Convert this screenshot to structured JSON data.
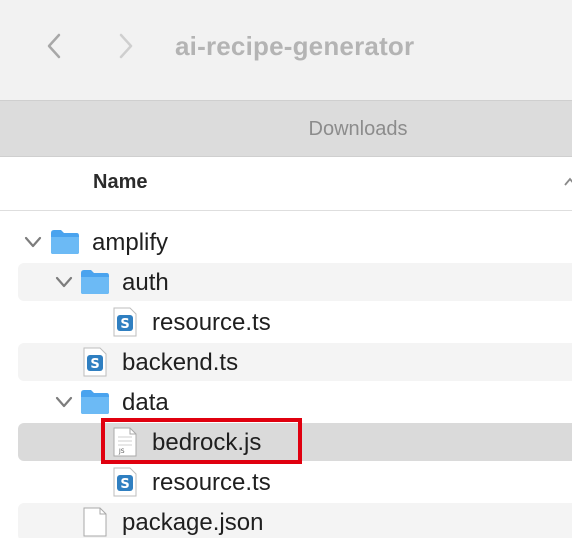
{
  "window": {
    "title": "ai-recipe-generator"
  },
  "tabbar": {
    "tab_label": "Downloads"
  },
  "columns": {
    "name_header": "Name"
  },
  "colors": {
    "highlight": "#e0000f",
    "folder": "#5aaef0",
    "swift_badge": "#2f7fc1"
  },
  "files": [
    {
      "name": "amplify",
      "type": "folder",
      "icon": "folder-icon",
      "expanded": true
    },
    {
      "name": "auth",
      "type": "folder",
      "icon": "folder-icon",
      "expanded": true
    },
    {
      "name": "resource.ts",
      "type": "file",
      "icon": "ts-file-icon"
    },
    {
      "name": "backend.ts",
      "type": "file",
      "icon": "ts-file-icon"
    },
    {
      "name": "data",
      "type": "folder",
      "icon": "folder-icon",
      "expanded": true
    },
    {
      "name": "bedrock.js",
      "type": "file",
      "icon": "js-file-icon",
      "selected": true,
      "badge": "JS"
    },
    {
      "name": "resource.ts",
      "type": "file",
      "icon": "ts-file-icon"
    },
    {
      "name": "package.json",
      "type": "file",
      "icon": "generic-file-icon"
    }
  ]
}
